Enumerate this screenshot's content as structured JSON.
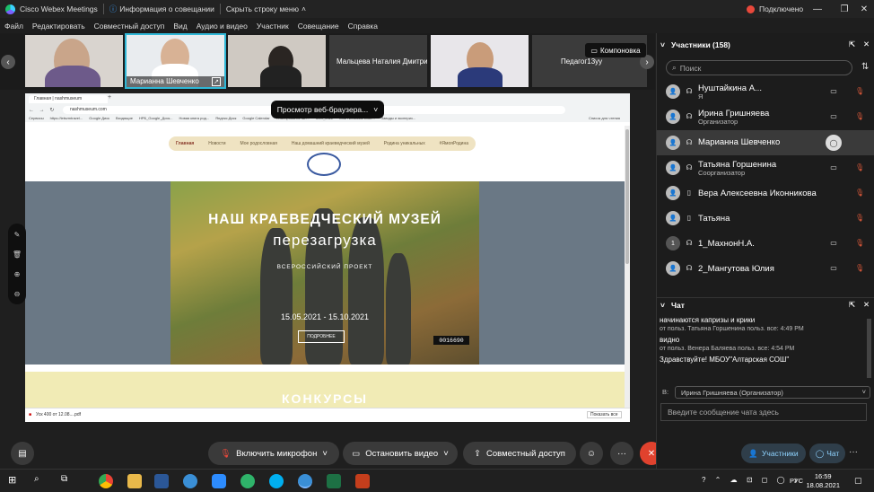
{
  "titlebar": {
    "app_title": "Cisco Webex Meetings",
    "meeting_info": "Информация о совещании",
    "hide_bar": "Скрыть строку меню",
    "status": "Подключено"
  },
  "menu": [
    "Файл",
    "Редактировать",
    "Совместный доступ",
    "Вид",
    "Аудио и видео",
    "Участник",
    "Совещание",
    "Справка"
  ],
  "strip": {
    "tiles": [
      "",
      "Марианна Шевченко",
      "",
      "Мальцева Наталия Дмитри...",
      "",
      "Педагог13уу"
    ],
    "layout_label": "Компоновка"
  },
  "share": {
    "tab_title": "Главная | nashmuseum",
    "url": "nashmuseum.com",
    "bookmarks": [
      "Сервисы",
      "https://letsvmtravel...",
      "Google Диск",
      "Входящие",
      "НРБ_Google_Доск...",
      "Новая книга род...",
      "Яндекс.Диск",
      "Google Calendar",
      "Планирование акт...",
      "КОС_2022",
      "Мой любимый клас...",
      "Заводы и экспериз..."
    ],
    "bookmarks_right": "Список для чтения",
    "nav": [
      "Главная",
      "Новости",
      "Мое родословная",
      "Наш домашний краеведческий музей",
      "Родина уникальных",
      "#ЯмояРодина"
    ],
    "hero_title1": "НАШ КРАЕВЕДЧЕСКИЙ МУЗЕЙ",
    "hero_title2": "перезагрузка",
    "hero_subtitle": "ВСЕРОССИЙСКИЙ ПРОЕКТ",
    "hero_dates": "15.05.2021 - 15.10.2021",
    "hero_button": "ПОДРОБНЕЕ",
    "counter": "0016690",
    "section_title": "КОНКУРСЫ",
    "download_file": "Уск 400 от 12.08....pdf",
    "show_all": "Показать все",
    "browser_view": "Просмотр веб-браузера..."
  },
  "controls": {
    "mic": "Включить микрофон",
    "video": "Остановить видео",
    "share": "Совместный доступ",
    "participants_btn": "Участники",
    "chat_btn": "Чат"
  },
  "participants": {
    "header": "Участники (158)",
    "search_placeholder": "Поиск",
    "list": [
      {
        "name": "Нуштайкина А...",
        "role": "Я"
      },
      {
        "name": "Ирина Гришняева",
        "role": "Организатор"
      },
      {
        "name": "Марианна Шевченко",
        "role": ""
      },
      {
        "name": "Татьяна Горшенина",
        "role": "Соорганизатор"
      },
      {
        "name": "Вера Алексеевна Иконникова",
        "role": ""
      },
      {
        "name": "Татьяна",
        "role": ""
      },
      {
        "name": "1_МахнонН.А.",
        "role": ""
      },
      {
        "name": "2_Мангутова Юлия",
        "role": ""
      }
    ],
    "avatar_num": "1"
  },
  "chat": {
    "header": "Чат",
    "lines": [
      {
        "text": "начинаются капризы и крики",
        "meta": false
      },
      {
        "text": "от польз. Татьяна Горшенина польз. все:    4:49 PM",
        "meta": true
      },
      {
        "text": "видно",
        "meta": false
      },
      {
        "text": "от польз. Венера Баляева польз. все:    4:54 PM",
        "meta": true
      },
      {
        "text": "Здравствуйте! МБОУ\"Алтарская СОШ\"",
        "meta": false
      }
    ],
    "to_label": "В:",
    "to_value": "Ирина Гришняева (Организатор)",
    "input_placeholder": "Введите сообщение чата здесь"
  },
  "taskbar": {
    "lang": "РУС",
    "time": "16:59",
    "date": "18.08.2021"
  }
}
